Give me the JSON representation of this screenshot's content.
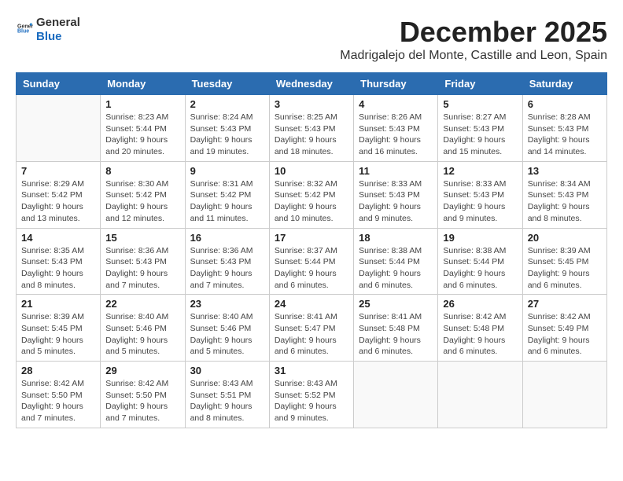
{
  "logo": {
    "line1": "General",
    "line2": "Blue"
  },
  "header": {
    "month_year": "December 2025",
    "location": "Madrigalejo del Monte, Castille and Leon, Spain"
  },
  "weekdays": [
    "Sunday",
    "Monday",
    "Tuesday",
    "Wednesday",
    "Thursday",
    "Friday",
    "Saturday"
  ],
  "weeks": [
    [
      {
        "day": "",
        "content": ""
      },
      {
        "day": "1",
        "content": "Sunrise: 8:23 AM\nSunset: 5:44 PM\nDaylight: 9 hours\nand 20 minutes."
      },
      {
        "day": "2",
        "content": "Sunrise: 8:24 AM\nSunset: 5:43 PM\nDaylight: 9 hours\nand 19 minutes."
      },
      {
        "day": "3",
        "content": "Sunrise: 8:25 AM\nSunset: 5:43 PM\nDaylight: 9 hours\nand 18 minutes."
      },
      {
        "day": "4",
        "content": "Sunrise: 8:26 AM\nSunset: 5:43 PM\nDaylight: 9 hours\nand 16 minutes."
      },
      {
        "day": "5",
        "content": "Sunrise: 8:27 AM\nSunset: 5:43 PM\nDaylight: 9 hours\nand 15 minutes."
      },
      {
        "day": "6",
        "content": "Sunrise: 8:28 AM\nSunset: 5:43 PM\nDaylight: 9 hours\nand 14 minutes."
      }
    ],
    [
      {
        "day": "7",
        "content": "Sunrise: 8:29 AM\nSunset: 5:42 PM\nDaylight: 9 hours\nand 13 minutes."
      },
      {
        "day": "8",
        "content": "Sunrise: 8:30 AM\nSunset: 5:42 PM\nDaylight: 9 hours\nand 12 minutes."
      },
      {
        "day": "9",
        "content": "Sunrise: 8:31 AM\nSunset: 5:42 PM\nDaylight: 9 hours\nand 11 minutes."
      },
      {
        "day": "10",
        "content": "Sunrise: 8:32 AM\nSunset: 5:42 PM\nDaylight: 9 hours\nand 10 minutes."
      },
      {
        "day": "11",
        "content": "Sunrise: 8:33 AM\nSunset: 5:43 PM\nDaylight: 9 hours\nand 9 minutes."
      },
      {
        "day": "12",
        "content": "Sunrise: 8:33 AM\nSunset: 5:43 PM\nDaylight: 9 hours\nand 9 minutes."
      },
      {
        "day": "13",
        "content": "Sunrise: 8:34 AM\nSunset: 5:43 PM\nDaylight: 9 hours\nand 8 minutes."
      }
    ],
    [
      {
        "day": "14",
        "content": "Sunrise: 8:35 AM\nSunset: 5:43 PM\nDaylight: 9 hours\nand 8 minutes."
      },
      {
        "day": "15",
        "content": "Sunrise: 8:36 AM\nSunset: 5:43 PM\nDaylight: 9 hours\nand 7 minutes."
      },
      {
        "day": "16",
        "content": "Sunrise: 8:36 AM\nSunset: 5:43 PM\nDaylight: 9 hours\nand 7 minutes."
      },
      {
        "day": "17",
        "content": "Sunrise: 8:37 AM\nSunset: 5:44 PM\nDaylight: 9 hours\nand 6 minutes."
      },
      {
        "day": "18",
        "content": "Sunrise: 8:38 AM\nSunset: 5:44 PM\nDaylight: 9 hours\nand 6 minutes."
      },
      {
        "day": "19",
        "content": "Sunrise: 8:38 AM\nSunset: 5:44 PM\nDaylight: 9 hours\nand 6 minutes."
      },
      {
        "day": "20",
        "content": "Sunrise: 8:39 AM\nSunset: 5:45 PM\nDaylight: 9 hours\nand 6 minutes."
      }
    ],
    [
      {
        "day": "21",
        "content": "Sunrise: 8:39 AM\nSunset: 5:45 PM\nDaylight: 9 hours\nand 5 minutes."
      },
      {
        "day": "22",
        "content": "Sunrise: 8:40 AM\nSunset: 5:46 PM\nDaylight: 9 hours\nand 5 minutes."
      },
      {
        "day": "23",
        "content": "Sunrise: 8:40 AM\nSunset: 5:46 PM\nDaylight: 9 hours\nand 5 minutes."
      },
      {
        "day": "24",
        "content": "Sunrise: 8:41 AM\nSunset: 5:47 PM\nDaylight: 9 hours\nand 6 minutes."
      },
      {
        "day": "25",
        "content": "Sunrise: 8:41 AM\nSunset: 5:48 PM\nDaylight: 9 hours\nand 6 minutes."
      },
      {
        "day": "26",
        "content": "Sunrise: 8:42 AM\nSunset: 5:48 PM\nDaylight: 9 hours\nand 6 minutes."
      },
      {
        "day": "27",
        "content": "Sunrise: 8:42 AM\nSunset: 5:49 PM\nDaylight: 9 hours\nand 6 minutes."
      }
    ],
    [
      {
        "day": "28",
        "content": "Sunrise: 8:42 AM\nSunset: 5:50 PM\nDaylight: 9 hours\nand 7 minutes."
      },
      {
        "day": "29",
        "content": "Sunrise: 8:42 AM\nSunset: 5:50 PM\nDaylight: 9 hours\nand 7 minutes."
      },
      {
        "day": "30",
        "content": "Sunrise: 8:43 AM\nSunset: 5:51 PM\nDaylight: 9 hours\nand 8 minutes."
      },
      {
        "day": "31",
        "content": "Sunrise: 8:43 AM\nSunset: 5:52 PM\nDaylight: 9 hours\nand 9 minutes."
      },
      {
        "day": "",
        "content": ""
      },
      {
        "day": "",
        "content": ""
      },
      {
        "day": "",
        "content": ""
      }
    ]
  ]
}
